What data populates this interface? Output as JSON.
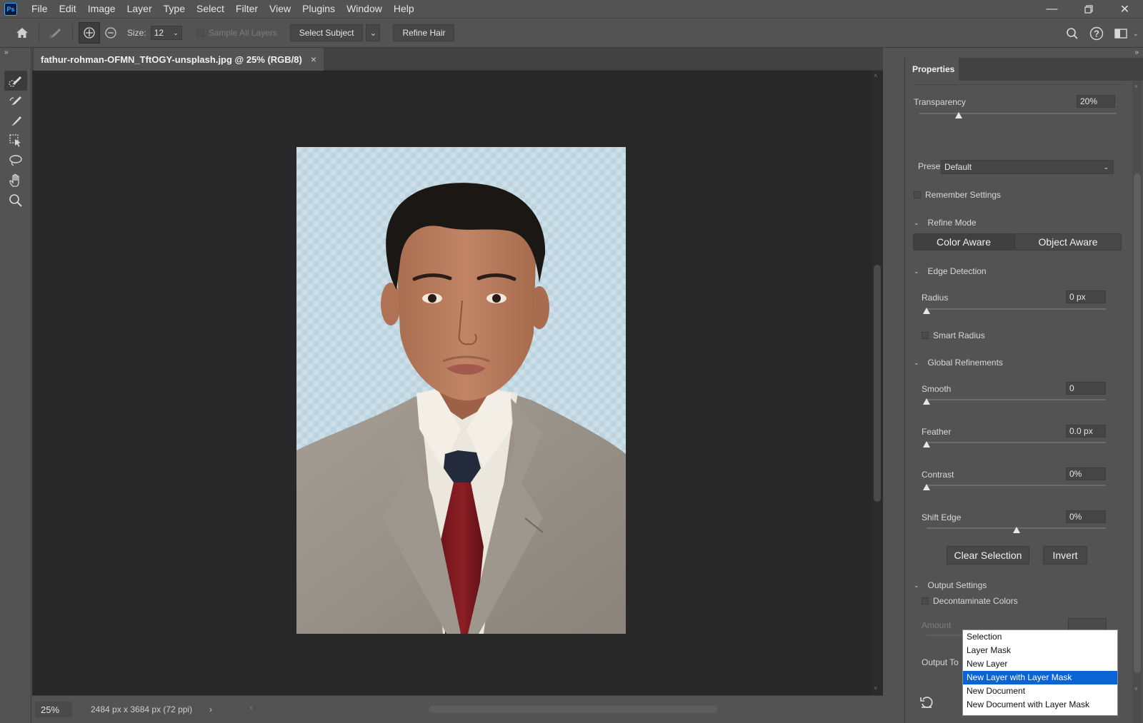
{
  "app": {
    "logo": "Ps"
  },
  "menu": [
    "File",
    "Edit",
    "Image",
    "Layer",
    "Type",
    "Select",
    "Filter",
    "View",
    "Plugins",
    "Window",
    "Help"
  ],
  "options_bar": {
    "size_label": "Size:",
    "size_value": "12",
    "sample_all_layers": "Sample All Layers",
    "select_subject": "Select Subject",
    "refine_hair": "Refine Hair"
  },
  "document": {
    "tab_title": "fathur-rohman-OFMN_TftOGY-unsplash.jpg @ 25% (RGB/8)",
    "zoom": "25%",
    "info": "2484 px x 3684 px (72 ppi)"
  },
  "properties": {
    "tab": "Properties",
    "transparency_label": "Transparency",
    "transparency_value": "20%",
    "transparency_level": 0.2,
    "preset_label": "Preset",
    "preset_value": "Default",
    "remember_settings": "Remember Settings",
    "refine_mode": {
      "title": "Refine Mode",
      "color_aware": "Color Aware",
      "object_aware": "Object Aware"
    },
    "edge_detection": {
      "title": "Edge Detection",
      "radius_label": "Radius",
      "radius_value": "0 px",
      "smart_radius": "Smart Radius"
    },
    "global_refinements": {
      "title": "Global Refinements",
      "smooth_label": "Smooth",
      "smooth_value": "0",
      "feather_label": "Feather",
      "feather_value": "0.0 px",
      "contrast_label": "Contrast",
      "contrast_value": "0%",
      "shift_edge_label": "Shift Edge",
      "shift_edge_value": "0%"
    },
    "clear_selection": "Clear Selection",
    "invert": "Invert",
    "output_settings": {
      "title": "Output Settings",
      "decontaminate": "Decontaminate Colors",
      "amount_label": "Amount",
      "output_to_label": "Output To"
    }
  },
  "output_menu": {
    "options": [
      "Selection",
      "Layer Mask",
      "New Layer",
      "New Layer with Layer Mask",
      "New Document",
      "New Document with Layer Mask"
    ],
    "selected": "New Layer with Layer Mask"
  },
  "colors": {
    "ui_bg": "#535353",
    "canvas_bg": "#282828",
    "accent": "#0a64d6"
  }
}
